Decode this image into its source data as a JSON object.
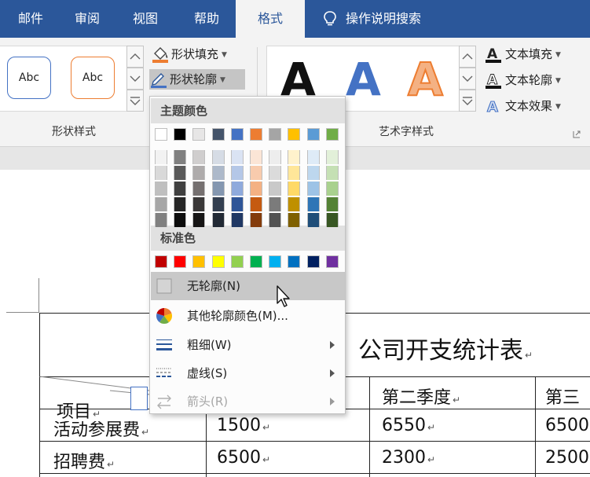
{
  "tabs": [
    {
      "label": "邮件",
      "active": false
    },
    {
      "label": "审阅",
      "active": false
    },
    {
      "label": "视图",
      "active": false
    },
    {
      "label": "帮助",
      "active": false
    },
    {
      "label": "格式",
      "active": true
    }
  ],
  "tell_me": {
    "label": "操作说明搜索",
    "icon": "lightbulb-icon"
  },
  "shape_styles": {
    "samples": [
      "Abc",
      "Abc"
    ],
    "fill_label": "形状填充",
    "outline_label": "形状轮廓",
    "group_label": "形状样式"
  },
  "wordart": {
    "letters": [
      "A",
      "A",
      "A"
    ],
    "text_fill_label": "文本填充",
    "text_outline_label": "文本轮廓",
    "text_effect_label": "文本效果",
    "group_label": "艺术字样式"
  },
  "outline_menu": {
    "theme_colors_label": "主题颜色",
    "standard_colors_label": "标准色",
    "theme_colors": [
      [
        "#ffffff",
        "#f2f2f2",
        "#d9d9d9",
        "#bfbfbf",
        "#a6a6a6",
        "#808080"
      ],
      [
        "#000000",
        "#808080",
        "#595959",
        "#404040",
        "#262626",
        "#0d0d0d"
      ],
      [
        "#e7e6e6",
        "#d0cece",
        "#aeabab",
        "#757070",
        "#3a3838",
        "#171616"
      ],
      [
        "#44546a",
        "#d6dce5",
        "#adb9ca",
        "#8497b0",
        "#333f50",
        "#222a35"
      ],
      [
        "#4472c4",
        "#dae3f3",
        "#b4c7e7",
        "#8faadc",
        "#2f5597",
        "#203864"
      ],
      [
        "#ed7d31",
        "#fbe5d6",
        "#f8cbad",
        "#f4b183",
        "#c55a11",
        "#843c0c"
      ],
      [
        "#a5a5a5",
        "#ededed",
        "#dbdbdb",
        "#c9c9c9",
        "#7b7b7b",
        "#525252"
      ],
      [
        "#ffc000",
        "#fff2cc",
        "#ffe699",
        "#ffd966",
        "#bf9000",
        "#7f6000"
      ],
      [
        "#5b9bd5",
        "#deebf7",
        "#bdd7ee",
        "#9dc3e6",
        "#2e75b6",
        "#1f4e79"
      ],
      [
        "#70ad47",
        "#e2f0d9",
        "#c5e0b4",
        "#a9d18e",
        "#548235",
        "#385723"
      ]
    ],
    "standard_colors": [
      "#c00000",
      "#ff0000",
      "#ffc000",
      "#ffff00",
      "#92d050",
      "#00b050",
      "#00b0f0",
      "#0070c0",
      "#002060",
      "#7030a0"
    ],
    "items": [
      {
        "label": "无轮廓(N)",
        "icon": "no-outline-swatch-icon",
        "hover": true,
        "submenu": false,
        "disabled": false
      },
      {
        "label": "其他轮廓颜色(M)...",
        "icon": "color-wheel-icon",
        "hover": false,
        "submenu": false,
        "disabled": false
      },
      {
        "label": "粗细(W)",
        "icon": "line-weight-icon",
        "hover": false,
        "submenu": true,
        "disabled": false
      },
      {
        "label": "虚线(S)",
        "icon": "dashes-icon",
        "hover": false,
        "submenu": true,
        "disabled": false
      },
      {
        "label": "箭头(R)",
        "icon": "arrows-icon",
        "hover": false,
        "submenu": true,
        "disabled": true
      }
    ]
  },
  "document": {
    "table_title": "公司开支统计表",
    "header_cells": [
      "项目",
      "第二季度",
      "第三"
    ],
    "rows": [
      [
        "活动参展费",
        "1500",
        "6550",
        "6500"
      ],
      [
        "招聘费",
        "6500",
        "2300",
        "2500"
      ]
    ],
    "paragraph_mark": "↵"
  },
  "colors": {
    "tab_bar": "#2b579a",
    "ribbon": "#f3f3f3",
    "wordart_black": "#111111",
    "wordart_blue": "#4472c4",
    "wordart_orange": "#f4b183"
  }
}
